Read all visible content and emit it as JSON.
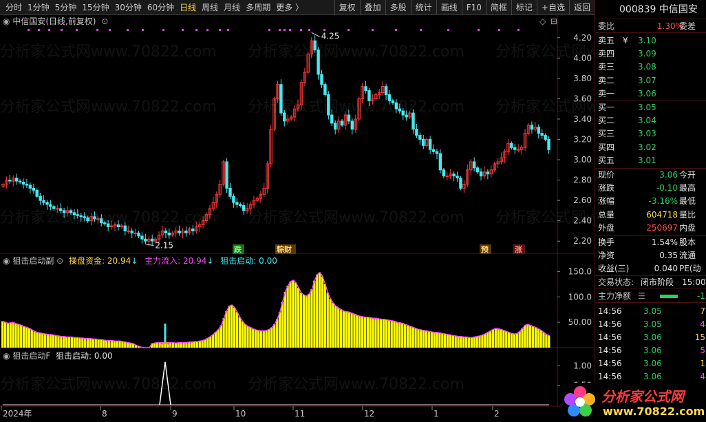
{
  "toolbar": {
    "periods": [
      "分时",
      "1分钟",
      "5分钟",
      "15分钟",
      "30分钟",
      "60分钟",
      "日线",
      "周线",
      "月线",
      "多周期",
      "更多 〉"
    ],
    "active_period": "日线",
    "actions": [
      "复权",
      "叠加",
      "多股",
      "统计",
      "画线",
      "F10",
      "简框",
      "标记",
      "+自选",
      "返回"
    ]
  },
  "chart": {
    "title": "中信国安(日线,前复权)",
    "high_label": "4.25",
    "low_label": "2.15",
    "y_ticks": [
      "4.20",
      "4.00",
      "3.80",
      "3.60",
      "3.40",
      "3.20",
      "3.00",
      "2.80",
      "2.60",
      "2.40",
      "2.20"
    ],
    "signals": [
      {
        "text": "跌"
      },
      {
        "text": "粽财"
      },
      {
        "text": "预"
      },
      {
        "text": "涨"
      }
    ],
    "x_ticks": [
      "2024年",
      "8",
      "9",
      "10",
      "11",
      "12",
      "1",
      "2"
    ]
  },
  "indicator1": {
    "name": "狙击启动副",
    "s1_label": "操盘资金: 20.94",
    "s1_arrow": "↓",
    "s2_label": "主力流入: 20.94",
    "s2_arrow": "↓",
    "s3_label": "狙击启动: 0.00",
    "y_ticks": [
      "150.0",
      "100.0",
      "50.00"
    ]
  },
  "indicator2": {
    "name": "狙击启动F",
    "s1_label": "狙击启动: 0.00",
    "y_ticks": [
      "1.00",
      "0.50"
    ]
  },
  "quote": {
    "code": "000839",
    "name": "中信国安",
    "weibi_label": "委比",
    "weibi_value": "1.30%",
    "weicha_label": "委差",
    "asks": [
      {
        "label": "卖五",
        "flag": "¥",
        "price": "3.10"
      },
      {
        "label": "卖四",
        "price": "3.09"
      },
      {
        "label": "卖三",
        "price": "3.08"
      },
      {
        "label": "卖二",
        "price": "3.07"
      },
      {
        "label": "卖一",
        "price": "3.06"
      }
    ],
    "bids": [
      {
        "label": "买一",
        "price": "3.05"
      },
      {
        "label": "买二",
        "price": "3.04"
      },
      {
        "label": "买三",
        "price": "3.03"
      },
      {
        "label": "买四",
        "price": "3.02"
      },
      {
        "label": "买五",
        "price": "3.01"
      }
    ],
    "stats": [
      {
        "label": "现价",
        "value": "3.06",
        "label2": "今开"
      },
      {
        "label": "涨跌",
        "value": "-0.10",
        "label2": "最高"
      },
      {
        "label": "涨幅",
        "value": "-3.16%",
        "label2": "最低"
      },
      {
        "label": "总量",
        "value": "604718",
        "label2": "量比"
      },
      {
        "label": "外盘",
        "value": "250697",
        "label2": "内盘"
      }
    ],
    "stats2": [
      {
        "label": "换手",
        "value": "1.54%",
        "label2": "股本"
      },
      {
        "label": "净资",
        "value": "0.35",
        "label2": "流通"
      },
      {
        "label": "收益(三)",
        "value": "0.040",
        "label2": "PE(动"
      }
    ],
    "trade_status_label": "交易状态:",
    "trade_status_value": "闭市阶段",
    "trade_status_time": "15:00",
    "main_net_label": "主力净额",
    "main_net_value": "-1",
    "ticks": [
      {
        "time": "14:56",
        "price": "3.05",
        "vol": "7"
      },
      {
        "time": "14:56",
        "price": "3.05",
        "vol": "4"
      },
      {
        "time": "14:56",
        "price": "3.06",
        "vol": "15"
      },
      {
        "time": "14:56",
        "price": "3.06",
        "vol": "5"
      },
      {
        "time": "14:56",
        "price": "3.06",
        "vol": "1"
      },
      {
        "time": "14:56",
        "price": "3.06",
        "vol": "4"
      }
    ]
  },
  "watermark": "分析家公式网www.70822.com",
  "logo": {
    "title": "分析家公式网",
    "url": "www.70822.com"
  },
  "colors": {
    "up": "#ff3b3b",
    "down": "#48e8f0",
    "bar_fill": "#ffff00",
    "bar_edge": "#ff44ff",
    "bg": "#000000"
  },
  "chart_data": [
    {
      "type": "candlestick",
      "title": "中信国安(日线,前复权)",
      "ylim": [
        2.1,
        4.3
      ],
      "x_ticks": [
        "2024年",
        "8",
        "9",
        "10",
        "11",
        "12",
        "1",
        "2"
      ],
      "close": [
        2.76,
        2.8,
        2.79,
        2.82,
        2.79,
        2.78,
        2.76,
        2.75,
        2.72,
        2.7,
        2.64,
        2.6,
        2.58,
        2.56,
        2.54,
        2.52,
        2.52,
        2.5,
        2.48,
        2.5,
        2.48,
        2.46,
        2.45,
        2.44,
        2.43,
        2.4,
        2.44,
        2.42,
        2.42,
        2.38,
        2.37,
        2.34,
        2.35,
        2.36,
        2.34,
        2.35,
        2.3,
        2.3,
        2.28,
        2.28,
        2.25,
        2.22,
        2.2,
        2.22,
        2.2,
        2.22,
        2.26,
        2.3,
        2.28,
        2.26,
        2.28,
        2.3,
        2.28,
        2.3,
        2.28,
        2.32,
        2.3,
        2.34,
        2.36,
        2.4,
        2.46,
        2.52,
        2.58,
        2.66,
        2.76,
        2.98,
        2.72,
        2.64,
        2.58,
        2.56,
        2.55,
        2.5,
        2.52,
        2.56,
        2.6,
        2.62,
        2.66,
        2.72,
        2.96,
        3.3,
        3.6,
        3.74,
        3.46,
        3.38,
        3.4,
        3.42,
        3.5,
        3.54,
        3.76,
        3.86,
        4.04,
        4.17,
        4.08,
        3.84,
        3.74,
        3.64,
        3.44,
        3.36,
        3.3,
        3.38,
        3.34,
        3.44,
        3.38,
        3.3,
        3.4,
        3.6,
        3.72,
        3.68,
        3.58,
        3.6,
        3.64,
        3.66,
        3.72,
        3.64,
        3.58,
        3.56,
        3.5,
        3.48,
        3.44,
        3.42,
        3.46,
        3.3,
        3.24,
        3.2,
        3.14,
        3.2,
        3.1,
        3.08,
        3.06,
        2.9,
        2.84,
        2.84,
        2.86,
        2.84,
        2.82,
        2.72,
        2.76,
        2.9,
        2.98,
        2.92,
        2.88,
        2.84,
        2.88,
        2.86,
        2.9,
        2.96,
        2.98,
        3.02,
        3.08,
        3.16,
        3.12,
        3.1,
        3.1,
        3.12,
        3.26,
        3.34,
        3.3,
        3.32,
        3.26,
        3.24,
        3.2,
        3.1
      ]
    },
    {
      "type": "bar",
      "name": "操盘资金",
      "ylim": [
        0,
        160
      ],
      "values": [
        52,
        50,
        48,
        49,
        50,
        47,
        46,
        44,
        42,
        40,
        38,
        35,
        32,
        30,
        29,
        28,
        27,
        26,
        26,
        25,
        24,
        23,
        22,
        22,
        21,
        21,
        21,
        20,
        20,
        19,
        19,
        18,
        18,
        18,
        17,
        17,
        16,
        16,
        15,
        14,
        14,
        14,
        13,
        13,
        13,
        12,
        11,
        10,
        9,
        8,
        5,
        3,
        1,
        0,
        0,
        0,
        8,
        9,
        10,
        10,
        10,
        10,
        10,
        10,
        10,
        9,
        10,
        10,
        10,
        10,
        11,
        11,
        12,
        12,
        13,
        14,
        16,
        19,
        22,
        26,
        31,
        36,
        44,
        58,
        72,
        82,
        84,
        79,
        70,
        60,
        52,
        46,
        42,
        40,
        37,
        35,
        34,
        33,
        33,
        34,
        36,
        40,
        46,
        56,
        70,
        90,
        110,
        122,
        130,
        133,
        128,
        118,
        108,
        104,
        102,
        106,
        115,
        132,
        144,
        148,
        140,
        125,
        108,
        96,
        88,
        82,
        78,
        75,
        72,
        71,
        70,
        68,
        66,
        64,
        62,
        61,
        60,
        60,
        59,
        58,
        58,
        57,
        56,
        56,
        55,
        54,
        53,
        52,
        50,
        49,
        48,
        46,
        44,
        42,
        40,
        38,
        36,
        35,
        34,
        33,
        32,
        31,
        30,
        30,
        29,
        28,
        27,
        26,
        25,
        24,
        23,
        22,
        22,
        21,
        21,
        20,
        20,
        21,
        22,
        23,
        25,
        27,
        30,
        33,
        36,
        38,
        37,
        36,
        34,
        32,
        30,
        28,
        27,
        28,
        32,
        38,
        44,
        46,
        44,
        42,
        40,
        37,
        34,
        30,
        26,
        24
      ]
    },
    {
      "type": "line",
      "name": "狙击启动",
      "ylim": [
        0,
        1.2
      ],
      "values": [
        0,
        0,
        0,
        0,
        0,
        0,
        0,
        0,
        0,
        0,
        0,
        0,
        0,
        0,
        0,
        0,
        0,
        0,
        0,
        0,
        0,
        0,
        0,
        0,
        0,
        0,
        0,
        0,
        0,
        0,
        0,
        0,
        0,
        0,
        0,
        0,
        0,
        0,
        0,
        0,
        0,
        0,
        0,
        0,
        0,
        0,
        0,
        0,
        0,
        0,
        0,
        0,
        0,
        0,
        0,
        0,
        0,
        0,
        0,
        0,
        0,
        0,
        0,
        0,
        0,
        0,
        0,
        0,
        0,
        0,
        0,
        0,
        0,
        0,
        0,
        0,
        0,
        0,
        0,
        0,
        0,
        0,
        0,
        0,
        0,
        0,
        0,
        0,
        0,
        0,
        0,
        0,
        0,
        0,
        0,
        0,
        0,
        0,
        0,
        0,
        0,
        0,
        0,
        0,
        0,
        0,
        0,
        0,
        0,
        0,
        0,
        0,
        0,
        0,
        0,
        0,
        0,
        0,
        0,
        0,
        0,
        0,
        0,
        0,
        0,
        0,
        0,
        0,
        0,
        0,
        0,
        0,
        0,
        0,
        0,
        0,
        0,
        0,
        0,
        0,
        0,
        0,
        0,
        0,
        0,
        0,
        0,
        0,
        0,
        0,
        0,
        0,
        0,
        0,
        0,
        0,
        0,
        0,
        0,
        0,
        0,
        0,
        0,
        0,
        0,
        0,
        0,
        0,
        0,
        0,
        0,
        0,
        0,
        0,
        0,
        0,
        0,
        0,
        0,
        0,
        0,
        0,
        0,
        0,
        0,
        0,
        0,
        0,
        0,
        0,
        0,
        0,
        0,
        0,
        0,
        0,
        0,
        0,
        0,
        0,
        0,
        0,
        0,
        0,
        0,
        0,
        0,
        0,
        0,
        0,
        0,
        0,
        0,
        0,
        0,
        0,
        0,
        0
      ]
    }
  ]
}
